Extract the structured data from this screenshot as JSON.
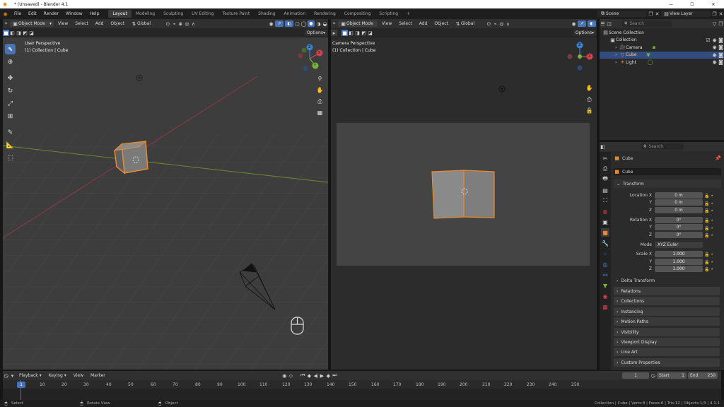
{
  "title_bar": {
    "title": "* (Unsaved) - Blender 4.1",
    "minimize": "—",
    "maximize": "☐",
    "close": "✕"
  },
  "menu": [
    "File",
    "Edit",
    "Render",
    "Window",
    "Help"
  ],
  "workspaces": [
    {
      "label": "Layout",
      "active": true
    },
    {
      "label": "Modeling"
    },
    {
      "label": "Sculpting"
    },
    {
      "label": "UV Editing"
    },
    {
      "label": "Texture Paint"
    },
    {
      "label": "Shading"
    },
    {
      "label": "Animation"
    },
    {
      "label": "Rendering"
    },
    {
      "label": "Compositing"
    },
    {
      "label": "Scripting"
    }
  ],
  "add_workspace": "+",
  "scene": {
    "label": "Scene"
  },
  "view_layer": {
    "label": "View Layer"
  },
  "left_viewport": {
    "mode": "Object Mode",
    "menus": [
      "View",
      "Select",
      "Add",
      "Object"
    ],
    "orientation": "Global",
    "options": "Options",
    "overlay_title": "User Perspective",
    "overlay_sub": "(1) Collection | Cube"
  },
  "right_viewport": {
    "mode": "Object Mode",
    "menus": [
      "View",
      "Select",
      "Add",
      "Object"
    ],
    "orientation": "Global",
    "options": "Options",
    "overlay_title": "Camera Perspective",
    "overlay_sub": "(1) Collection | Cube"
  },
  "gizmo": {
    "x": "X",
    "y": "Y",
    "z": "Z"
  },
  "outliner": {
    "search_placeholder": "Search",
    "items": [
      {
        "label": "Scene Collection",
        "indent": 0
      },
      {
        "label": "Collection",
        "indent": 1
      },
      {
        "label": "Camera",
        "indent": 2
      },
      {
        "label": "Cube",
        "indent": 2,
        "selected": true
      },
      {
        "label": "Light",
        "indent": 2
      }
    ]
  },
  "properties": {
    "search_placeholder": "Search",
    "object_name": "Cube",
    "data_name": "Cube",
    "transform_title": "Transform",
    "location": {
      "label": "Location X",
      "x": "0 m",
      "y": "0 m",
      "z": "0 m"
    },
    "rotation": {
      "label": "Rotation X",
      "x": "0°",
      "y": "0°",
      "z": "0°"
    },
    "mode": {
      "label": "Mode",
      "value": "XYZ Euler"
    },
    "scale": {
      "label": "Scale X",
      "x": "1.000",
      "y": "1.000",
      "z": "1.000"
    },
    "axis_y": "Y",
    "axis_z": "Z",
    "delta": "Delta Transform",
    "panels": [
      "Relations",
      "Collections",
      "Instancing",
      "Motion Paths",
      "Visibility",
      "Viewport Display",
      "Line Art",
      "Custom Properties"
    ]
  },
  "timeline": {
    "menus": [
      "Playback",
      "Keying",
      "View",
      "Marker"
    ],
    "current_frame": "1",
    "start_label": "Start",
    "start": "1",
    "end_label": "End",
    "end": "250",
    "ticks": [
      "1",
      "10",
      "20",
      "30",
      "40",
      "50",
      "60",
      "70",
      "80",
      "90",
      "100",
      "110",
      "120",
      "130",
      "140",
      "150",
      "160",
      "170",
      "180",
      "190",
      "200",
      "210",
      "220",
      "230",
      "240",
      "250"
    ]
  },
  "status_bar": {
    "select": "Select",
    "rotate": "Rotate View",
    "object": "Object",
    "stats": "Collection | Cube | Verts:8 | Faces:6 | Tris:12 | Objects:1/3 | 4.1.1"
  },
  "colors": {
    "accent": "#4772b3",
    "select_orange": "#e88a2d",
    "x_axis": "#d1434f",
    "y_axis": "#7ab33b",
    "z_axis": "#3b7fcf"
  }
}
